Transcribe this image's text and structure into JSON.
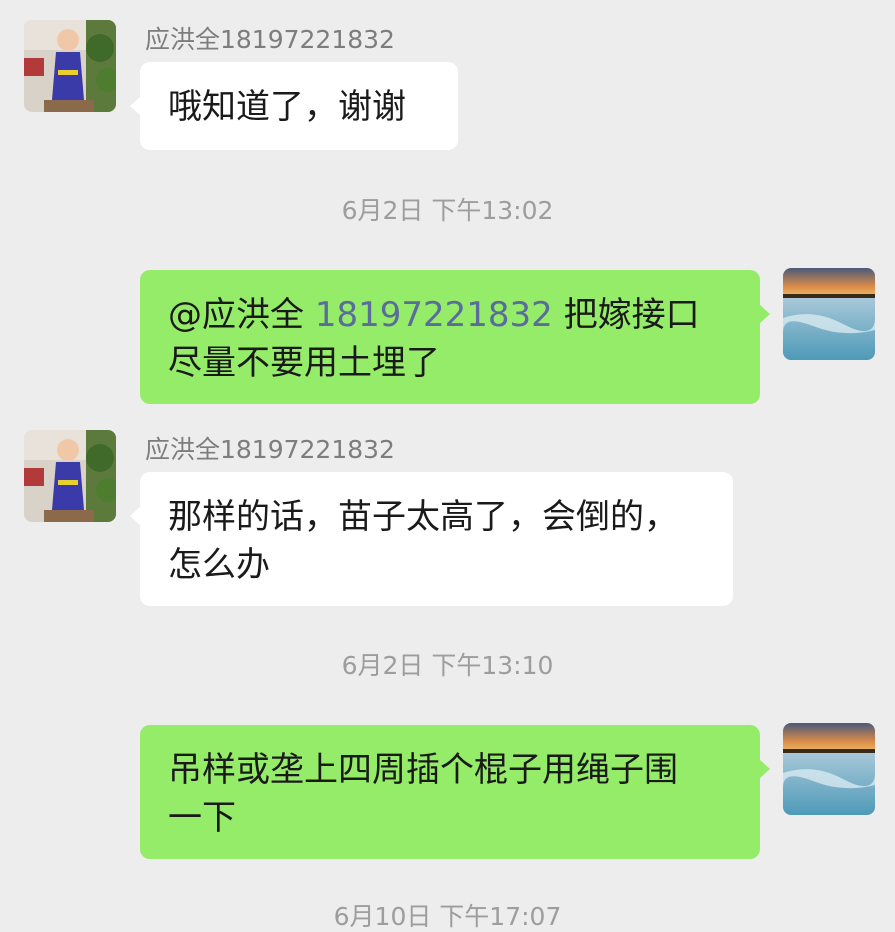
{
  "messages": [
    {
      "sender": "应洪全18197221832",
      "text": "哦知道了，谢谢"
    },
    {
      "timestamp": "6月2日 下午13:02"
    },
    {
      "mention": "@应洪全",
      "mention_number": "18197221832",
      "text_after_mention": "把嫁接口",
      "text_line2": "尽量不要用土埋了"
    },
    {
      "sender": "应洪全18197221832",
      "text_line1": "那样的话，苗子太高了，会倒的，",
      "text_line2": "怎么办"
    },
    {
      "timestamp": "6月2日 下午13:10"
    },
    {
      "text_line1": "吊样或垄上四周插个棍子用绳子围",
      "text_line2": "一下"
    },
    {
      "timestamp": "6月10日 下午17:07"
    }
  ],
  "colors": {
    "background": "#ededed",
    "incoming_bubble": "#ffffff",
    "outgoing_bubble": "#95ec69",
    "mention_number": "#5a6c9a"
  }
}
